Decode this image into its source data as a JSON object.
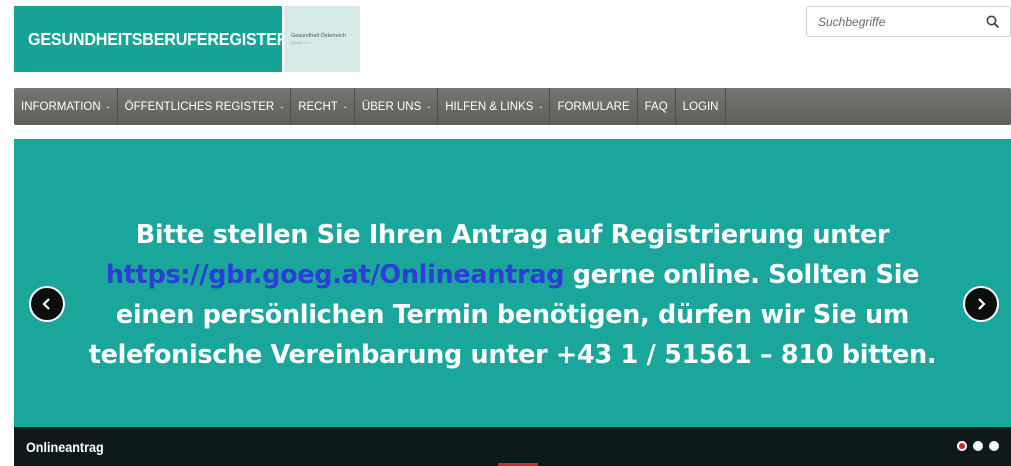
{
  "header": {
    "logo_text": "GESUNDHEITSBERUFEREGISTER",
    "partner_text": "Gesundheit Österreich",
    "partner_sub": "GmbH • • •",
    "search_placeholder": "Suchbegriffe"
  },
  "nav": {
    "items": [
      {
        "label": "INFORMATION",
        "dropdown": true
      },
      {
        "label": "ÖFFENTLICHES REGISTER",
        "dropdown": true
      },
      {
        "label": "RECHT",
        "dropdown": true
      },
      {
        "label": "ÜBER UNS",
        "dropdown": true
      },
      {
        "label": "HILFEN & LINKS",
        "dropdown": true
      },
      {
        "label": "FORMULARE",
        "dropdown": false
      },
      {
        "label": "FAQ",
        "dropdown": false
      },
      {
        "label": "LOGIN",
        "dropdown": false
      }
    ],
    "caret": "-"
  },
  "slider": {
    "line1": "Bitte stellen Sie Ihren Antrag auf Registrierung unter",
    "link": "https://gbr.goeg.at/Onlineantrag",
    "line2_rest": " gerne online. Sollten Sie",
    "line3": "einen persönlichen Termin benötigen, dürfen wir Sie um",
    "line4": "telefonische Vereinbarung unter +43 1 / 51561 – 810 bitten.",
    "caption": "Onlineantrag",
    "dots": 3,
    "active_dot": 0
  },
  "colors": {
    "brand_teal": "#17a497",
    "slide_bg": "#1aa69a",
    "link_blue": "#2b3fd8",
    "nav_bg": "#6a6b66",
    "accent_red": "#d0272c"
  }
}
